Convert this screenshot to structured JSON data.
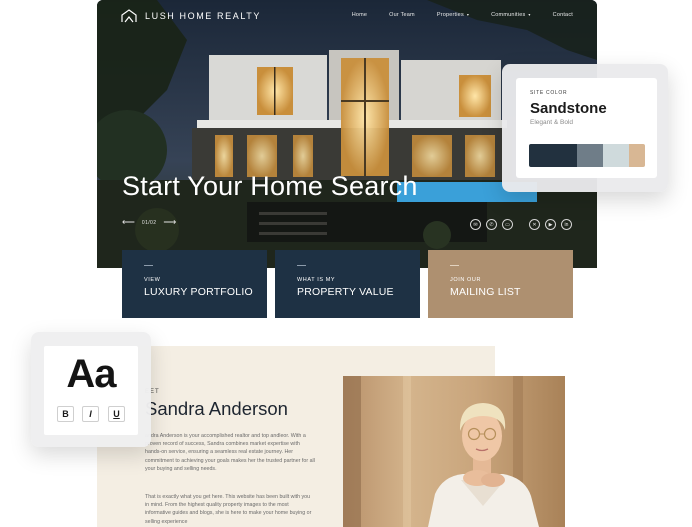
{
  "brand": {
    "name": "LUSH HOME REALTY"
  },
  "nav": {
    "items": [
      {
        "label": "Home",
        "dropdown": false
      },
      {
        "label": "Our Team",
        "dropdown": false
      },
      {
        "label": "Properties",
        "dropdown": true
      },
      {
        "label": "Communities",
        "dropdown": true
      },
      {
        "label": "Contact",
        "dropdown": false
      }
    ]
  },
  "hero": {
    "title": "Start Your Home Search",
    "slider_counter": "01/02",
    "social_icons": [
      "email-icon",
      "phone-icon",
      "chat-icon",
      "x-icon",
      "youtube-icon",
      "linkedin-icon"
    ]
  },
  "ctas": [
    {
      "small": "VIEW",
      "big": "LUXURY PORTFOLIO",
      "color": "#1e3144"
    },
    {
      "small": "WHAT IS MY",
      "big": "PROPERTY VALUE",
      "color": "#1e3144"
    },
    {
      "small": "JOIN OUR",
      "big": "MAILING LIST",
      "color": "#ae9070"
    }
  ],
  "site_color": {
    "label": "SITE COLOR",
    "name": "Sandstone",
    "subtitle": "Elegant & Bold",
    "swatches": [
      "#22313f",
      "#6f7d88",
      "#cfdadc",
      "#d8b794"
    ]
  },
  "typography": {
    "sample": "Aa",
    "bold": "B",
    "italic": "I",
    "underline": "U"
  },
  "about": {
    "meet_label": "EET",
    "name": "Sandra Anderson",
    "paragraph1": "andra Anderson is your accomplished realtor and top andleor. With a proven record of success, Sandra combines market expertise with hands-on service, ensuring a seamless real estate journey. Her commitment to achieving your goals makes her the trusted partner for all your buying and selling needs.",
    "paragraph2": "That is exactly what you get here. This website has been built with you in mind. From the highest quality property images to the most informative guides and blogs, she is here to make your home buying or selling experience"
  },
  "colors": {
    "navy": "#1e3144",
    "tan": "#ae9070",
    "about_bg": "#f4eee3"
  }
}
